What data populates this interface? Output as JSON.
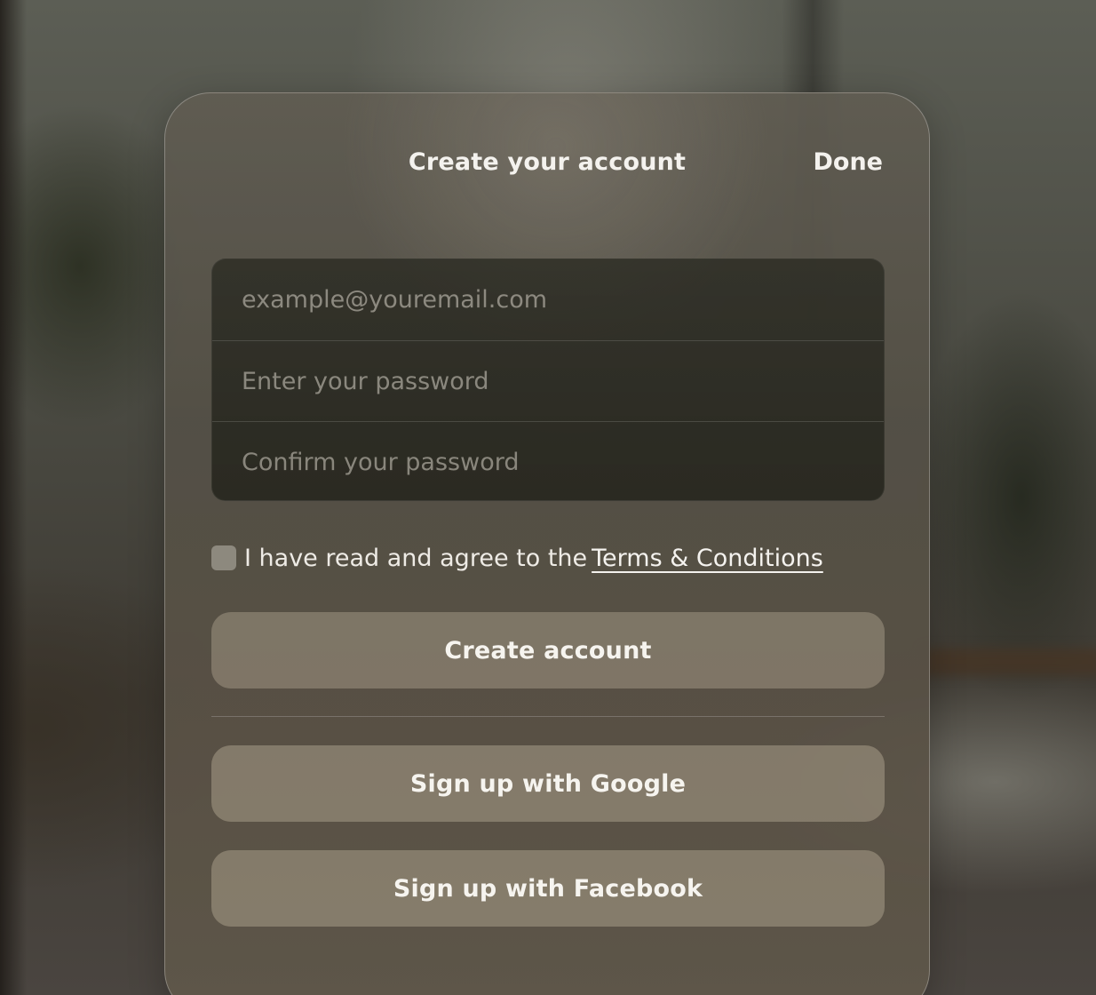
{
  "header": {
    "title": "Create your account",
    "done_label": "Done"
  },
  "form": {
    "email": {
      "placeholder": "example@youremail.com",
      "value": ""
    },
    "password": {
      "placeholder": "Enter your password",
      "value": ""
    },
    "confirm_password": {
      "placeholder": "Confirm your password",
      "value": ""
    },
    "agree": {
      "checked": false,
      "text": "I have read and agree to the",
      "link_label": "Terms & Conditions"
    }
  },
  "actions": {
    "create_label": "Create account",
    "google_label": "Sign up with Google",
    "facebook_label": "Sign up with Facebook"
  },
  "colors": {
    "panel": "#5c574d",
    "field_bg": "#2c2c24",
    "button": "#8a806c",
    "text": "#f4f2ee",
    "placeholder": "#9d998d"
  }
}
